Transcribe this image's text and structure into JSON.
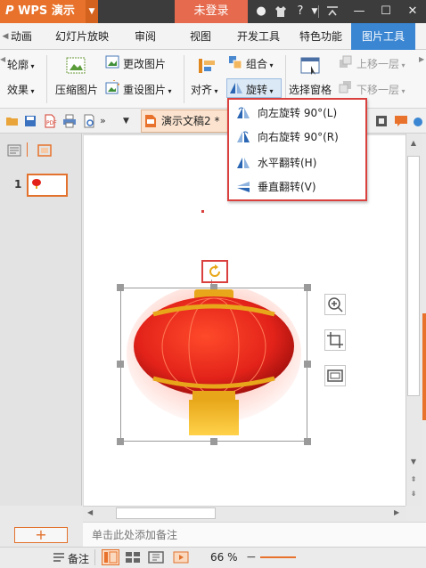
{
  "titlebar": {
    "app_name": "WPS 演示",
    "login": "未登录",
    "help_icon": "?",
    "minimize": "—",
    "restore": "☐",
    "close": "✕"
  },
  "tabs": [
    {
      "label": "动画"
    },
    {
      "label": "幻灯片放映"
    },
    {
      "label": "审阅"
    },
    {
      "label": "视图"
    },
    {
      "label": "开发工具"
    },
    {
      "label": "特色功能"
    },
    {
      "label": "图片工具"
    }
  ],
  "ribbon": {
    "outline_partial": "轮廓",
    "effect_partial": "效果",
    "compress": "压缩图片",
    "change_pic": "更改图片",
    "reset_pic": "重设图片",
    "align": "对齐",
    "group": "组合",
    "rotate": "旋转",
    "select_pane": "选择窗格",
    "bring_forward": "上移一层",
    "send_backward": "下移一层"
  },
  "quickbar": {
    "doc_tab": "演示文稿2 *"
  },
  "rotate_menu": [
    {
      "label": "向左旋转 90°(L)",
      "icon": "rotate-left-icon"
    },
    {
      "label": "向右旋转 90°(R)",
      "icon": "rotate-right-icon"
    },
    {
      "label": "水平翻转(H)",
      "icon": "flip-horizontal-icon"
    },
    {
      "label": "垂直翻转(V)",
      "icon": "flip-vertical-icon"
    }
  ],
  "slides_panel": {
    "slide_number": "1"
  },
  "notes_placeholder": "单击此处添加备注",
  "add_slide": "+",
  "status": {
    "notes_label": "备注",
    "zoom": "66 %"
  },
  "colors": {
    "accent_orange": "#e8722b",
    "active_tab": "#3a86d2",
    "highlight_red": "#d9403e",
    "lantern_red": "#e3231a",
    "lantern_gold": "#e8a71a"
  }
}
